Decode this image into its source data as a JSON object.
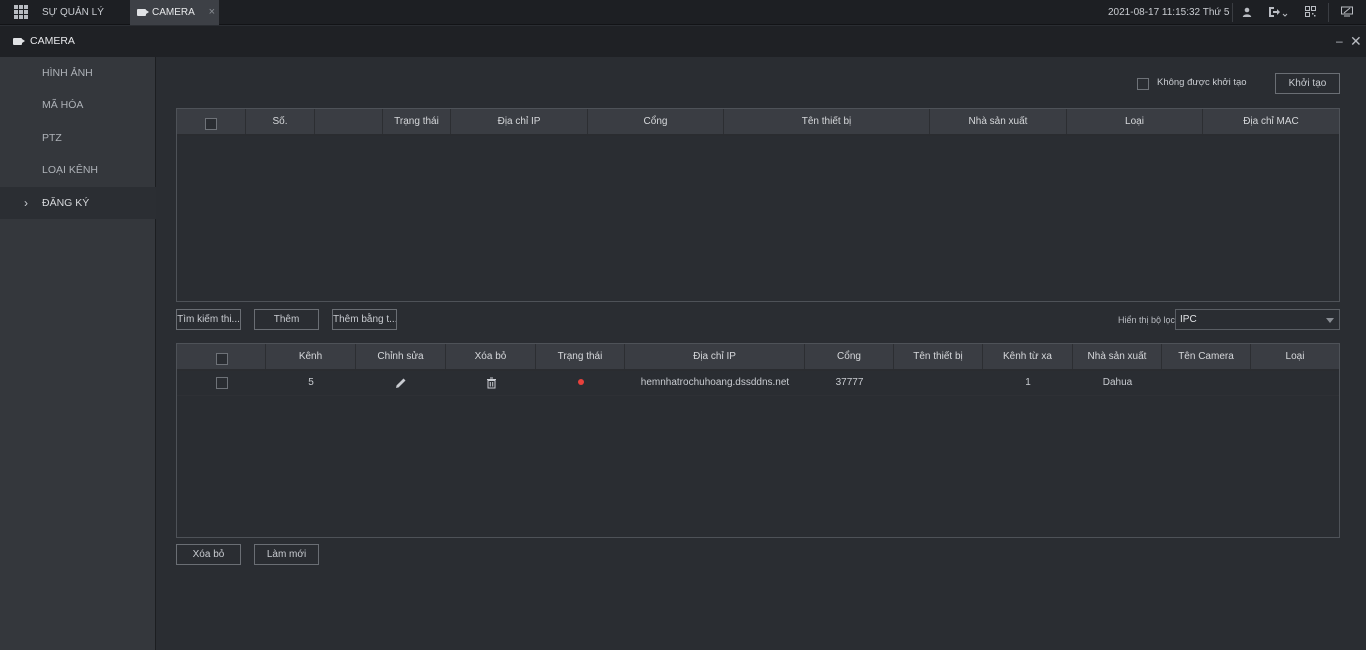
{
  "topbar": {
    "tab_management": "SỰ QUẢN LÝ",
    "tab_camera": "CAMERA",
    "tab_close": "×",
    "datetime": "2021-08-17 11:15:32 Thứ 5",
    "icons": [
      "apps-grid-icon",
      "user-icon",
      "logout-icon",
      "qrcode-icon",
      "monitor-icon"
    ]
  },
  "window": {
    "title": "CAMERA",
    "minimize": "–",
    "close": "✕"
  },
  "sidebar": {
    "items": [
      {
        "label": "HÌNH ẢNH"
      },
      {
        "label": "MÃ HÓA"
      },
      {
        "label": "PTZ"
      },
      {
        "label": "LOẠI KÊNH"
      },
      {
        "label": "ĐĂNG KÝ",
        "active": true
      }
    ],
    "active_marker": "›"
  },
  "init": {
    "checkbox_label": "Không được khởi tạo",
    "button": "Khởi tạo"
  },
  "device_table": {
    "headers": [
      "Số.",
      "",
      "Trạng thái",
      "Địa chỉ IP",
      "Cổng",
      "Tên thiết bị",
      "Nhà sản xuất",
      "Loại",
      "Địa chỉ MAC"
    ],
    "rows": []
  },
  "mid_toolbar": {
    "search_button": "Tìm kiếm thi...",
    "add_button": "Thêm",
    "manual_add_button": "Thêm bằng t...",
    "filter_label": "Hiển thị bộ lọc",
    "filter_value": "IPC"
  },
  "camera_table": {
    "headers": [
      "Kênh",
      "Chỉnh sửa",
      "Xóa bỏ",
      "Trạng thái",
      "Địa chỉ IP",
      "Cổng",
      "Tên thiết bị",
      "Kênh từ xa",
      "Nhà sản xuất",
      "Tên Camera",
      "Loại"
    ],
    "rows": [
      {
        "channel": "5",
        "status_color": "#e8413c",
        "ip": "hemnhatrochuhoang.dssddns.net",
        "port": "37777",
        "device_name": "",
        "remote_channel": "1",
        "manufacturer": "Dahua",
        "camera_name": "",
        "type": ""
      }
    ]
  },
  "bottom_toolbar": {
    "delete_button": "Xóa bỏ",
    "refresh_button": "Làm mới"
  }
}
